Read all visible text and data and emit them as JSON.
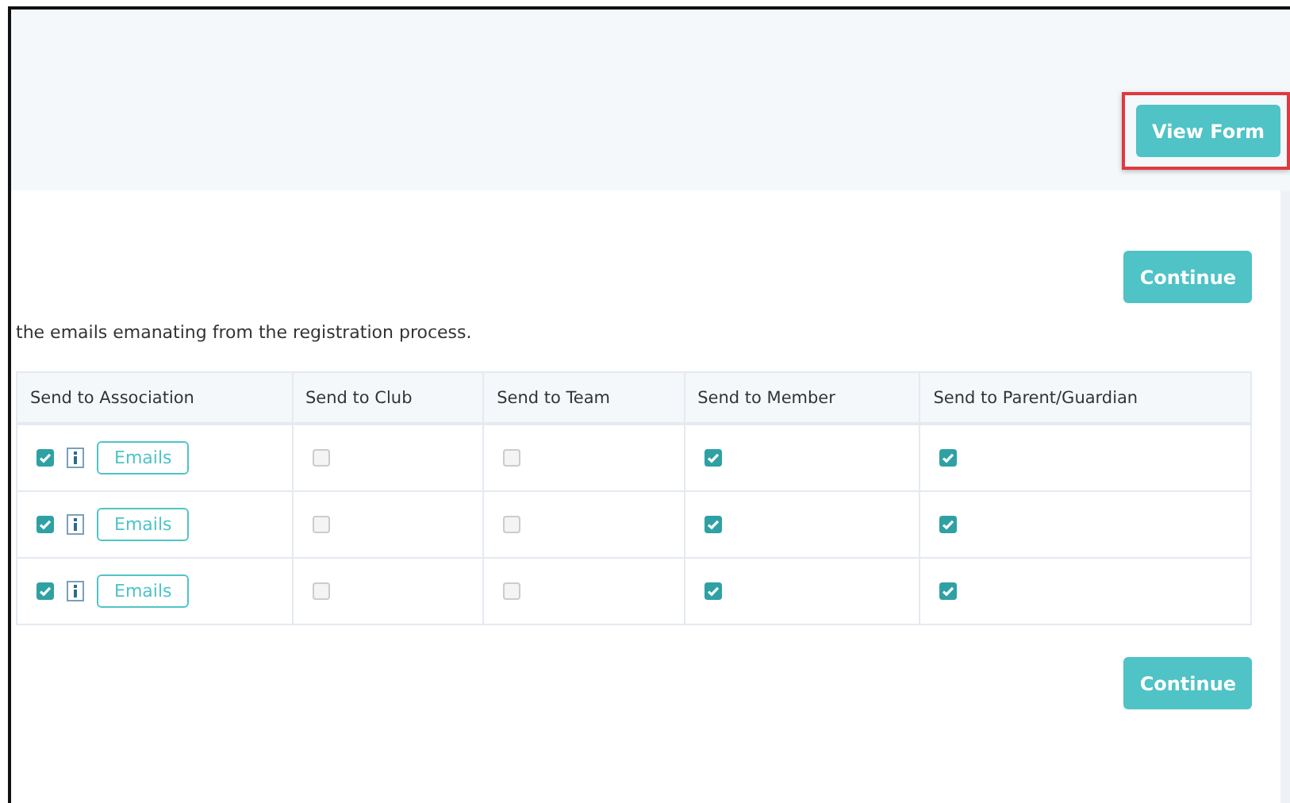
{
  "header": {
    "view_form_button": {
      "label": "View Form",
      "highlighted": true
    }
  },
  "top_button": {
    "label": "Continue"
  },
  "intro": "the emails emanating from the registration process.",
  "table": {
    "columns": [
      "Send to Association",
      "Send to Club",
      "Send to Team",
      "Send to Member",
      "Send to Parent/Guardian"
    ],
    "rows": [
      {
        "association": {
          "checked": true,
          "button": "Emails"
        },
        "club": {
          "checked": false,
          "disabled": true
        },
        "team": {
          "checked": false,
          "disabled": true
        },
        "member": {
          "checked": true,
          "disabled": false
        },
        "parent": {
          "checked": true,
          "disabled": false
        }
      },
      {
        "association": {
          "checked": true,
          "button": "Emails"
        },
        "club": {
          "checked": false,
          "disabled": true
        },
        "team": {
          "checked": false,
          "disabled": true
        },
        "member": {
          "checked": true,
          "disabled": false
        },
        "parent": {
          "checked": true,
          "disabled": false
        }
      },
      {
        "association": {
          "checked": true,
          "button": "Emails"
        },
        "club": {
          "checked": false,
          "disabled": true
        },
        "team": {
          "checked": false,
          "disabled": true
        },
        "member": {
          "checked": true,
          "disabled": false
        },
        "parent": {
          "checked": true,
          "disabled": false
        }
      }
    ]
  },
  "bottom_button": {
    "label": "Continue"
  }
}
